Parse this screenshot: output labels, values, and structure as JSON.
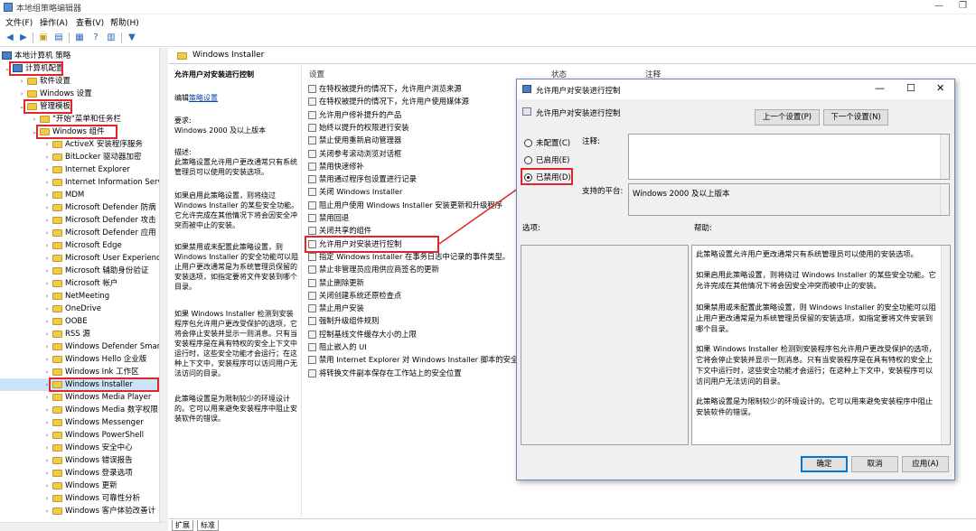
{
  "window": {
    "title": "本地组策略编辑器"
  },
  "menu": [
    "文件(F)",
    "操作(A)",
    "查看(V)",
    "帮助(H)"
  ],
  "tree": {
    "root": "本地计算机 策略",
    "items": [
      {
        "label": "计算机配置",
        "level": 1,
        "expanded": true,
        "highlight": true
      },
      {
        "label": "软件设置",
        "level": 2
      },
      {
        "label": "Windows 设置",
        "level": 2
      },
      {
        "label": "管理模板",
        "level": 2,
        "expanded": true,
        "highlight": true
      },
      {
        "label": "\"开始\"菜单和任务栏",
        "level": 3
      },
      {
        "label": "Windows 组件",
        "level": 3,
        "expanded": true,
        "highlight": true
      },
      {
        "label": "ActiveX 安装程序服务",
        "level": 4
      },
      {
        "label": "BitLocker 驱动器加密",
        "level": 4
      },
      {
        "label": "Internet Explorer",
        "level": 4
      },
      {
        "label": "Internet Information Serv",
        "level": 4
      },
      {
        "label": "MDM",
        "level": 4
      },
      {
        "label": "Microsoft Defender 防病",
        "level": 4
      },
      {
        "label": "Microsoft Defender 攻击",
        "level": 4
      },
      {
        "label": "Microsoft Defender 应用",
        "level": 4
      },
      {
        "label": "Microsoft Edge",
        "level": 4
      },
      {
        "label": "Microsoft User Experienc",
        "level": 4
      },
      {
        "label": "Microsoft 辅助身份验证",
        "level": 4
      },
      {
        "label": "Microsoft 帐户",
        "level": 4
      },
      {
        "label": "NetMeeting",
        "level": 4
      },
      {
        "label": "OneDrive",
        "level": 4
      },
      {
        "label": "OOBE",
        "level": 4
      },
      {
        "label": "RSS 源",
        "level": 4
      },
      {
        "label": "Windows Defender Smar",
        "level": 4
      },
      {
        "label": "Windows Hello 企业版",
        "level": 4
      },
      {
        "label": "Windows Ink 工作区",
        "level": 4
      },
      {
        "label": "Windows Installer",
        "level": 4,
        "selected": true,
        "highlight": true
      },
      {
        "label": "Windows Media Player",
        "level": 4
      },
      {
        "label": "Windows Media 数字权限",
        "level": 4
      },
      {
        "label": "Windows Messenger",
        "level": 4
      },
      {
        "label": "Windows PowerShell",
        "level": 4
      },
      {
        "label": "Windows 安全中心",
        "level": 4
      },
      {
        "label": "Windows 错误报告",
        "level": 4
      },
      {
        "label": "Windows 登录选项",
        "level": 4
      },
      {
        "label": "Windows 更新",
        "level": 4
      },
      {
        "label": "Windows 可靠性分析",
        "level": 4
      },
      {
        "label": "Windows 客户体验改善计",
        "level": 4
      }
    ]
  },
  "right": {
    "header": "Windows Installer",
    "desc": {
      "title": "允许用户对安装进行控制",
      "edit_prefix": "编辑",
      "edit_link": "策略设置",
      "req_label": "要求:",
      "req_value": "Windows 2000 及以上版本",
      "desc_label": "描述:",
      "p1": "此策略设置允许用户更改通常只有系统管理员可以使用的安装选项。",
      "p2": "如果启用此策略设置，则将绕过 Windows Installer 的某些安全功能。它允许完成在其他情况下将会因安全冲突而被中止的安装。",
      "p3": "如果禁用或未配置此策略设置，则 Windows Installer 的安全功能可以阻止用户更改通常是为系统管理员保留的安装选项，如指定要将文件安装到哪个目录。",
      "p4": "如果 Windows Installer 检测到安装程序包允许用户更改受保护的选项，它将会停止安装并显示一则消息。只有当安装程序是在具有特权的安全上下文中运行时，这些安全功能才会运行；在这种上下文中，安装程序可以访问用户无法访问的目录。",
      "p5": "此策略设置是为限制较少的环境设计的。它可以用来避免安装程序中阻止安装软件的错误。"
    },
    "columns": {
      "setting": "设置",
      "state": "状态",
      "comment": "注释"
    },
    "settings": [
      "在特权被提升的情况下，允许用户浏览来源",
      "在特权被提升的情况下，允许用户使用媒体源",
      "允许用户修补提升的产品",
      "始终以提升的权限进行安装",
      "禁止使用重新启动管理器",
      "关闭参考滚动浏览对话框",
      "禁用快速修补",
      "禁用通过程序包设置进行记录",
      "关闭 Windows Installer",
      "阻止用户使用 Windows Installer 安装更新和升级程序",
      "禁用回退",
      "关闭共享的组件",
      "允许用户对安装进行控制",
      "指定 Windows Installer 在事务日志中记录的事件类型。",
      "禁止非管理员应用供应商签名的更新",
      "禁止删除更新",
      "关闭创建系统还原检查点",
      "禁止用户安装",
      "强制升级组件规则",
      "控制基线文件缓存大小的上限",
      "阻止嵌入的 UI",
      "禁用 Internet Explorer 对 Windows Installer 脚本的安全",
      "将转换文件副本保存在工作站上的安全位置"
    ],
    "tabs": [
      "扩展",
      "标准"
    ]
  },
  "dialog": {
    "title": "允许用户对安装进行控制",
    "setting_name": "允许用户对安装进行控制",
    "prev_button": "上一个设置(P)",
    "next_button": "下一个设置(N)",
    "radio_not_configured": "未配置(C)",
    "radio_enabled": "已启用(E)",
    "radio_disabled": "已禁用(D)",
    "comment_label": "注释:",
    "supported_label": "支持的平台:",
    "supported_value": "Windows 2000 及以上版本",
    "options_label": "选项:",
    "help_label": "帮助:",
    "help": {
      "p1": "此策略设置允许用户更改通常只有系统管理员可以使用的安装选项。",
      "p2": "如果启用此策略设置，则将绕过 Windows Installer 的某些安全功能。它允许完成在其他情况下将会因安全冲突而被中止的安装。",
      "p3": "如果禁用或未配置此策略设置，则 Windows Installer 的安全功能可以阻止用户更改通常是为系统管理员保留的安装选项，如指定要将文件安装到哪个目录。",
      "p4": "如果 Windows Installer 检测到安装程序包允许用户更改受保护的选项，它将会停止安装并显示一则消息。只有当安装程序是在具有特权的安全上下文中运行时，这些安全功能才会运行；在这种上下文中，安装程序可以访问用户无法访问的目录。",
      "p5": "此策略设置是为限制较少的环境设计的。它可以用来避免安装程序中阻止安装软件的错误。"
    },
    "ok_button": "确定",
    "cancel_button": "取消",
    "apply_button": "应用(A)",
    "selected_option": "disabled"
  },
  "colors": {
    "highlight": "#e0262a",
    "selection": "#cce4f7",
    "link": "#0645ad"
  }
}
